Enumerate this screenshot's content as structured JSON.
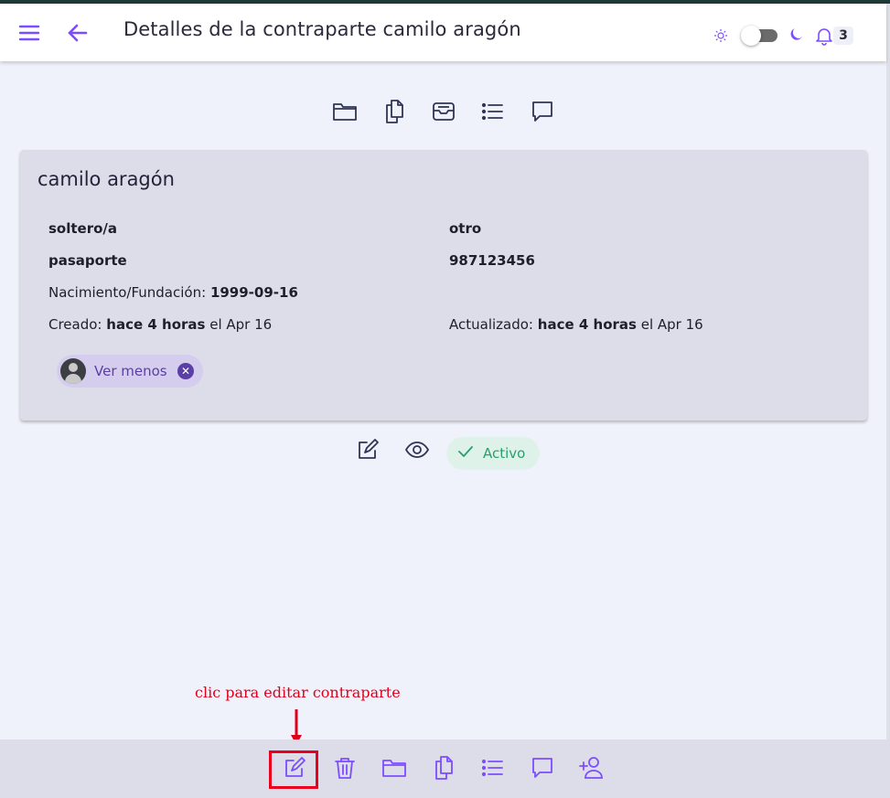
{
  "header": {
    "title": "Detalles de la contraparte camilo aragón",
    "notifications_count": "3",
    "dark_mode_enabled": false
  },
  "top_tabs": [
    "folder-icon",
    "documents-icon",
    "archive-icon",
    "list-icon",
    "comment-icon"
  ],
  "card": {
    "name": "camilo aragón",
    "marital_status": "soltero/a",
    "gender": "otro",
    "id_type": "pasaporte",
    "id_number": "987123456",
    "birth_label": "Nacimiento/Fundación:",
    "birth_value": "1999-09-16",
    "created_label": "Creado:",
    "created_value": "hace 4 horas",
    "created_date": "el Apr 16",
    "updated_label": "Actualizado:",
    "updated_value": "hace 4 horas",
    "updated_date": "el Apr 16",
    "chip_label": "Ver menos"
  },
  "status": {
    "label": "Activo"
  },
  "annotation": {
    "text": "clic para editar contraparte"
  },
  "bottom_bar": [
    "edit-icon",
    "trash-icon",
    "folder-icon",
    "documents-icon",
    "list-icon",
    "comment-icon",
    "add-user-icon"
  ],
  "colors": {
    "accent": "#7c4dff",
    "icon_dark": "#2f3553",
    "card_bg": "#dcdde8",
    "page_bg": "#f0f2fb",
    "status_green": "#27a06b",
    "annotation_red": "#e0001a"
  }
}
